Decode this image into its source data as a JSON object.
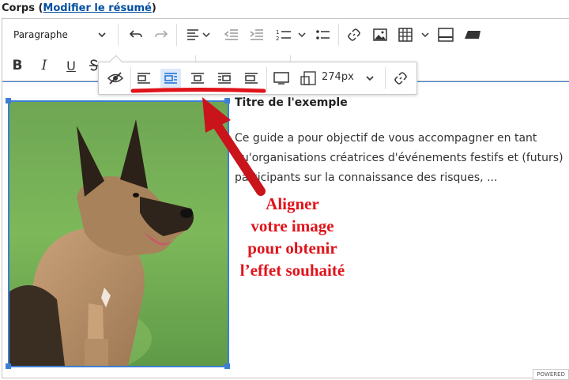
{
  "field": {
    "label": "Corps (",
    "link": "Modifier le résumé",
    "label_end": ")"
  },
  "toolbar": {
    "heading": "Paragraphe",
    "icons": [
      "chevron-down-icon",
      "undo-icon",
      "redo-icon",
      "align-icon",
      "outdent-icon",
      "indent-icon",
      "numbered-list-icon",
      "bulleted-list-icon",
      "link-icon",
      "image-icon",
      "table-icon",
      "horizontal-line-icon",
      "code-block-icon",
      "bold-icon",
      "italic-icon",
      "underline-icon",
      "strikethrough-icon"
    ],
    "bold": "B",
    "italic": "I",
    "underline": "U"
  },
  "image_toolbar": {
    "width_value": "274px",
    "buttons": [
      "toggle-caption",
      "align-left",
      "align-block-left",
      "align-center",
      "align-block-right",
      "align-right",
      "image-resize",
      "image-link"
    ]
  },
  "content": {
    "title": "Titre de l'exemple",
    "paragraph": "Ce guide a pour objectif de vous accompagner en tant qu'organisations créatrices d'événements festifs et (futurs) participants sur la connaissance des risques, ..."
  },
  "annotation": {
    "lines": [
      "Aligner",
      "votre image",
      "pour obtenir",
      "l’effet souhaité"
    ]
  },
  "powered": "POWERED",
  "colors": {
    "accent": "#3d7fd6",
    "annotation": "#e0131a",
    "link": "#0050a0"
  }
}
